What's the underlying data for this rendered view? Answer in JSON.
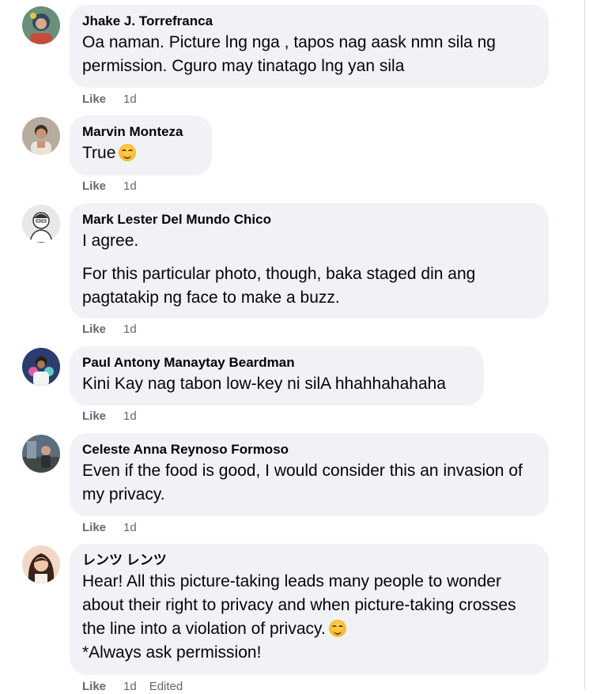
{
  "colors": {
    "bubble": "#f0f2f5",
    "meta_text": "#65676b",
    "text": "#050505"
  },
  "comments": [
    {
      "author": "Jhake J. Torrefranca",
      "paragraphs": [
        "Oa naman. Picture lng nga , tapos nag aask nmn sila ng permission. Cguro may tinatago lng yan sila"
      ],
      "like_label": "Like",
      "time": "1d",
      "avatar_icon": "profile-photo-icon"
    },
    {
      "author": "Marvin Monteza",
      "paragraphs": [
        "True"
      ],
      "emoji": "smiling-face-emoji",
      "like_label": "Like",
      "time": "1d",
      "avatar_icon": "profile-photo-icon"
    },
    {
      "author": "Mark Lester Del Mundo Chico",
      "paragraphs": [
        "I agree.",
        "For this particular photo, though, baka staged din ang pagtatakip ng face to make a buzz."
      ],
      "like_label": "Like",
      "time": "1d",
      "avatar_icon": "profile-photo-icon"
    },
    {
      "author": "Paul Antony Manaytay Beardman",
      "paragraphs": [
        "Kini Kay nag tabon low-key ni silA hhahhahahaha"
      ],
      "like_label": "Like",
      "time": "1d",
      "avatar_icon": "profile-photo-icon"
    },
    {
      "author": "Celeste Anna Reynoso Formoso",
      "paragraphs": [
        "Even if the food is good, I would consider this an invasion of my privacy."
      ],
      "like_label": "Like",
      "time": "1d",
      "avatar_icon": "profile-photo-icon"
    },
    {
      "author": "レンツ レンツ",
      "paragraphs": [
        "Hear! All this picture-taking leads many people to wonder about their right to privacy and when picture-taking crosses the line into a violation of privacy.",
        "*Always ask permission!"
      ],
      "emoji": "smiling-face-emoji",
      "like_label": "Like",
      "time": "1d",
      "edited_label": "Edited",
      "avatar_icon": "profile-photo-icon"
    }
  ]
}
